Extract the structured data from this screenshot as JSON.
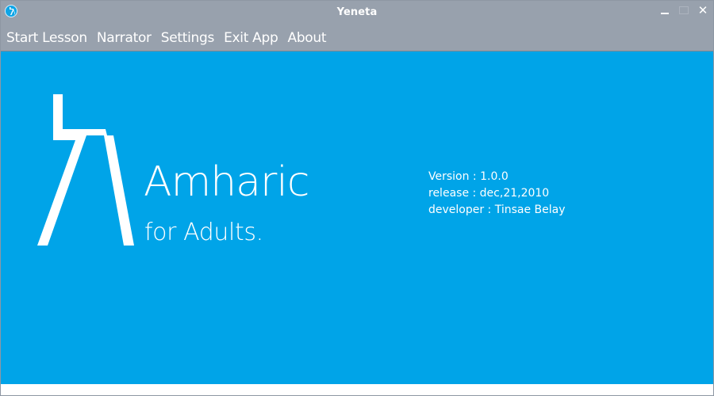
{
  "window": {
    "title": "Yeneta",
    "app_icon": "amharic-letter-icon",
    "controls": {
      "minimize_icon": "minimize-icon",
      "maximize_icon": "maximize-icon",
      "close_icon": "close-icon"
    }
  },
  "menu": {
    "items": [
      {
        "label": "Start Lesson"
      },
      {
        "label": "Narrator"
      },
      {
        "label": "Settings"
      },
      {
        "label": "Exit App"
      },
      {
        "label": "About"
      }
    ]
  },
  "main": {
    "logo_icon": "amharic-letter-icon",
    "brand_name": "Amharic",
    "tagline": "for Adults.",
    "version": "Version : 1.0.0",
    "release": "release : dec,21,2010",
    "developer": "developer : Tinsae Belay"
  },
  "colors": {
    "titlebar": "#98a1ad",
    "content_background": "#00a4e8",
    "text": "#ffffff"
  }
}
